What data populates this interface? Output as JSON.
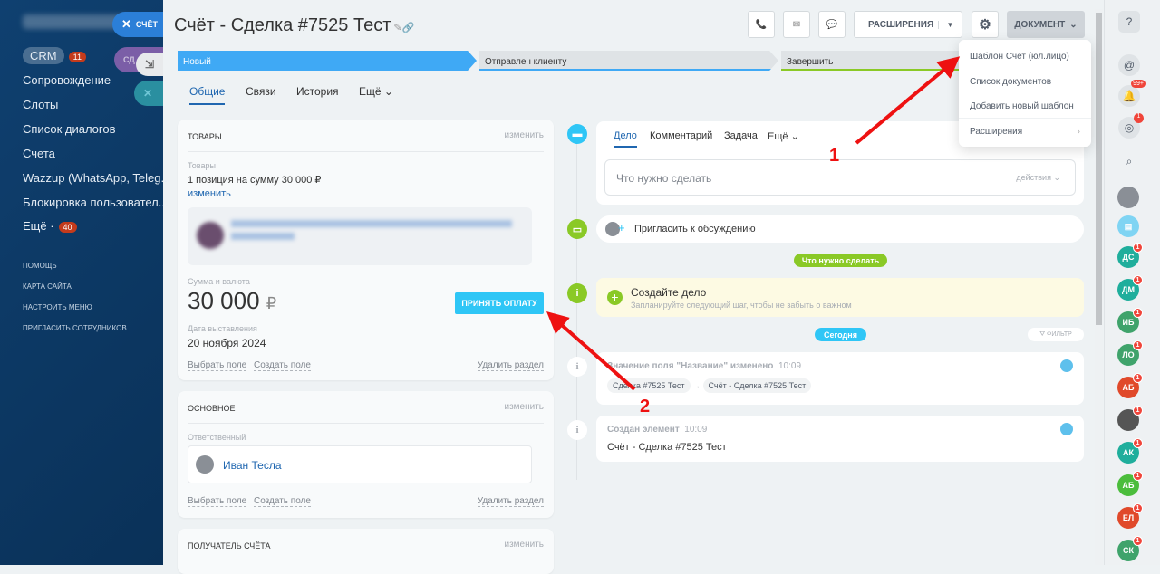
{
  "sidebar": {
    "crm": "CRM",
    "crm_badge": "11",
    "items": [
      "Сопровождение",
      "Слоты",
      "Список диалогов",
      "Счета",
      "Wazzup (WhatsApp, Teleg...",
      "Блокировка пользовател..."
    ],
    "more": "Ещё ·",
    "more_badge": "40",
    "footer": [
      "Помощь",
      "Карта сайта",
      "Настроить меню",
      "Пригласить сотрудников"
    ]
  },
  "slider_tabs": {
    "close_label": "СЧЁТ",
    "deal_label": "СД"
  },
  "header": {
    "title": "Счёт - Сделка #7525 Тест",
    "extensions": "РАСШИРЕНИЯ",
    "document": "ДОКУМЕНТ"
  },
  "stages": [
    "Новый",
    "Отправлен клиенту",
    "Завершить"
  ],
  "tabs": [
    "Общие",
    "Связи",
    "История",
    "Ещё"
  ],
  "goods": {
    "heading": "ТОВАРЫ",
    "edit": "изменить",
    "label": "Товары",
    "summary": "1 позиция на сумму 30 000 ₽",
    "change": "изменить",
    "sum_label": "Сумма и валюта",
    "sum": "30 000",
    "currency": "₽",
    "pay_button": "ПРИНЯТЬ ОПЛАТУ",
    "date_label": "Дата выставления",
    "date": "20 ноября 2024",
    "select_field": "Выбрать поле",
    "create_field": "Создать поле",
    "delete_section": "Удалить раздел"
  },
  "main_section": {
    "heading": "ОСНОВНОЕ",
    "edit": "изменить",
    "resp_label": "Ответственный",
    "resp": "Иван Тесла",
    "select_field": "Выбрать поле",
    "create_field": "Создать поле",
    "delete_section": "Удалить раздел"
  },
  "recipient": {
    "heading": "ПОЛУЧАТЕЛЬ СЧЁТА",
    "edit": "изменить"
  },
  "activity": {
    "tabs": [
      "Дело",
      "Комментарий",
      "Задача",
      "Ещё"
    ],
    "placeholder": "Что нужно сделать",
    "actions": "действия"
  },
  "invite": "Пригласить к обсуждению",
  "todo_pill": "Что нужно сделать",
  "create_task": {
    "title": "Создайте дело",
    "subtitle": "Запланируйте следующий шаг, чтобы не забыть о важном"
  },
  "today_pill": "Сегодня",
  "filter": "ФИЛЬТР",
  "history": [
    {
      "title": "Значение поля \"Название\" изменено",
      "time": "10:09",
      "from": "Сделка #7525 Тест",
      "to": "Счёт - Сделка #7525 Тест"
    },
    {
      "title": "Создан элемент",
      "time": "10:09",
      "text": "Счёт - Сделка #7525 Тест"
    }
  ],
  "document_menu": [
    "Шаблон Счет (юл.лицо)",
    "Список документов",
    "Добавить новый шаблон",
    "Расширения"
  ],
  "rightbar": {
    "notif_badge": "99+",
    "chat_badge": "1",
    "avatars": [
      {
        "initials": "ДС",
        "color": "#1fae9c"
      },
      {
        "initials": "ДМ",
        "color": "#1fae9c"
      },
      {
        "initials": "ИБ",
        "color": "#3fa36b"
      },
      {
        "initials": "ЛО",
        "color": "#3fa36b"
      },
      {
        "initials": "АБ",
        "color": "#e0492a"
      },
      {
        "initials": "",
        "color": "#555"
      },
      {
        "initials": "АК",
        "color": "#1fae9c"
      },
      {
        "initials": "АБ",
        "color": "#4bbd3c"
      },
      {
        "initials": "ЕЛ",
        "color": "#e0492a"
      },
      {
        "initials": "СК",
        "color": "#3fa36b"
      }
    ],
    "avatar_badge": "1"
  },
  "annotations": [
    "1",
    "2"
  ],
  "colors": {
    "accent": "#2fc6f6",
    "stage_new": "#3fa9f5",
    "arrow": "#ee1111",
    "green": "#8ac926"
  }
}
